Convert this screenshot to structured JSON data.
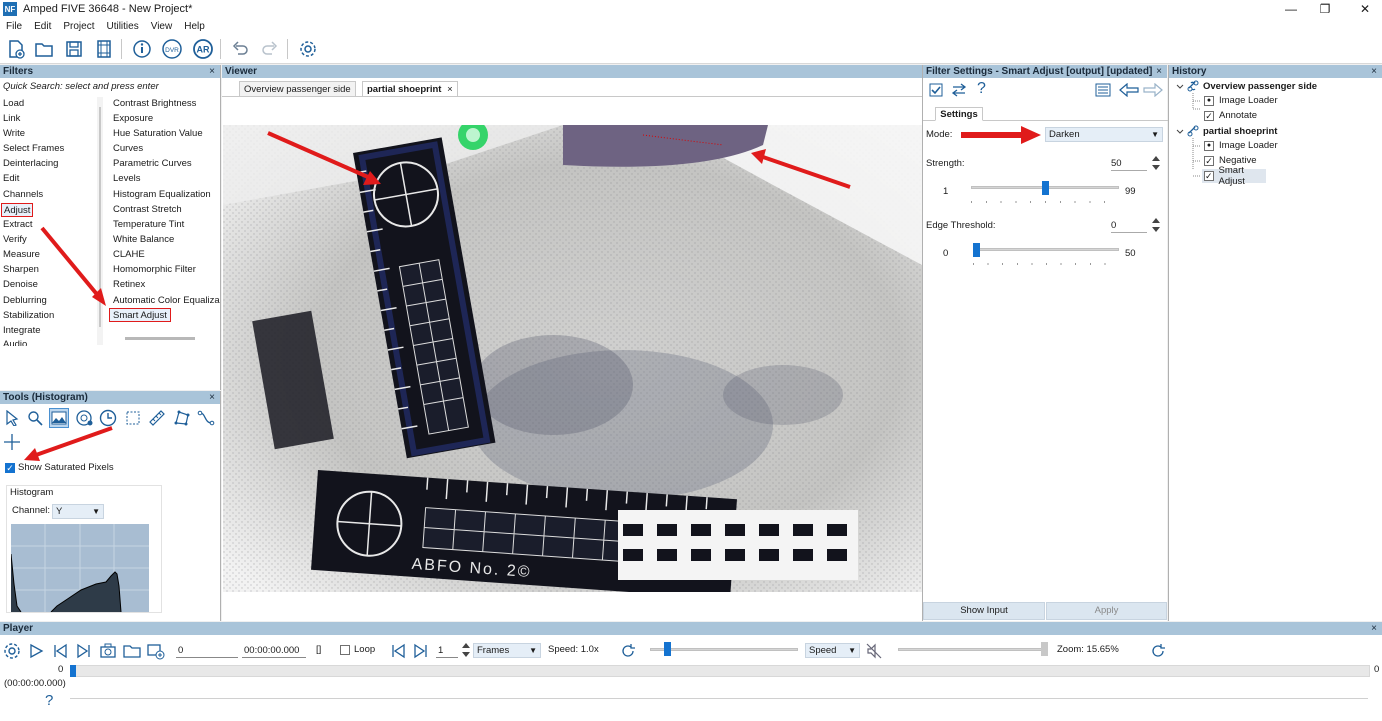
{
  "app": {
    "title": "Amped FIVE 36648 - New Project*",
    "logo_text": "NF"
  },
  "window": {
    "minimize": "—",
    "maximize": "❐",
    "close": "✕"
  },
  "menu": [
    "File",
    "Edit",
    "Project",
    "Utilities",
    "View",
    "Help"
  ],
  "toolbar": {
    "icons": [
      "new-project-icon",
      "open-icon",
      "save-icon",
      "video-icon",
      "info-icon",
      "dvr-icon",
      "ar-icon",
      "undo-icon",
      "redo-icon",
      "settings-icon"
    ],
    "dvr_label": "DVR",
    "ar_label": "AR"
  },
  "filters": {
    "title": "Filters",
    "close": "×",
    "search_placeholder": "Quick Search: select and press enter",
    "categories": [
      "Load",
      "Link",
      "Write",
      "Select Frames",
      "Deinterlacing",
      "Edit",
      "Channels",
      "Adjust",
      "Extract",
      "Verify",
      "Measure",
      "Sharpen",
      "Denoise",
      "Deblurring",
      "Stabilization",
      "Integrate",
      "Audio"
    ],
    "selected_category": "Adjust",
    "items": [
      "Contrast Brightness",
      "Exposure",
      "Hue Saturation Value",
      "Curves",
      "Parametric Curves",
      "Levels",
      "Histogram Equalization",
      "Contrast Stretch",
      "Temperature Tint",
      "White Balance",
      "CLAHE",
      "Homomorphic Filter",
      "Retinex",
      "Automatic Color Equaliza",
      "Smart Adjust"
    ],
    "selected_item": "Smart Adjust"
  },
  "tools": {
    "title": "Tools (Histogram)",
    "close": "×",
    "icons": [
      "pointer-icon",
      "zoom-icon",
      "histogram-icon",
      "color-picker-icon",
      "clock-icon",
      "rect-select-icon",
      "ruler-icon",
      "polygon-icon",
      "curve-icon",
      "crosshair-icon"
    ],
    "show_saturated_label": "Show Saturated Pixels",
    "show_saturated_checked": true,
    "histogram_title": "Histogram",
    "channel_label": "Channel:",
    "channel_value": "Y"
  },
  "viewer": {
    "title": "Viewer",
    "tabs": [
      {
        "label": "Overview passenger side",
        "active": false
      },
      {
        "label": "partial shoeprint",
        "active": true,
        "close": "×"
      }
    ],
    "image_text": "ABFO No. 2©"
  },
  "settings": {
    "title": "Filter Settings - Smart Adjust [output] [updated]",
    "close": "×",
    "tab_label": "Settings",
    "help": "?",
    "mode_label": "Mode:",
    "mode_value": "Darken",
    "strength_label": "Strength:",
    "strength_value": "50",
    "strength_min": "1",
    "strength_max": "99",
    "strength_level": 0.5,
    "edge_label": "Edge Threshold:",
    "edge_value": "0",
    "edge_min": "0",
    "edge_max": "50",
    "edge_level": 0.0,
    "show_input_label": "Show Input",
    "apply_label": "Apply"
  },
  "history": {
    "title": "History",
    "close": "×",
    "projects": [
      {
        "name": "Overview passenger side",
        "steps": [
          {
            "label": "Image Loader"
          },
          {
            "label": "Annotate"
          }
        ]
      },
      {
        "name": "partial shoeprint",
        "steps": [
          {
            "label": "Image Loader"
          },
          {
            "label": "Negative"
          },
          {
            "label": "Smart Adjust"
          }
        ]
      }
    ]
  },
  "player": {
    "title": "Player",
    "close": "×",
    "frame_value": "0",
    "time_value": "00:00:00.000",
    "brackets": "[]",
    "loop_label": "Loop",
    "step_value": "1",
    "unit_value": "Frames",
    "speed_text": "Speed: 1.0x",
    "speed_combo": "Speed",
    "zoom_text": "Zoom: 15.65%",
    "timeline_start": "0",
    "timeline_end": "0",
    "timecode": "(00:00:00.000)",
    "help": "?"
  },
  "colors": {
    "panel_header": "#a9c4d9",
    "accent": "#1473d0",
    "annotation_red": "#e01b1b"
  }
}
